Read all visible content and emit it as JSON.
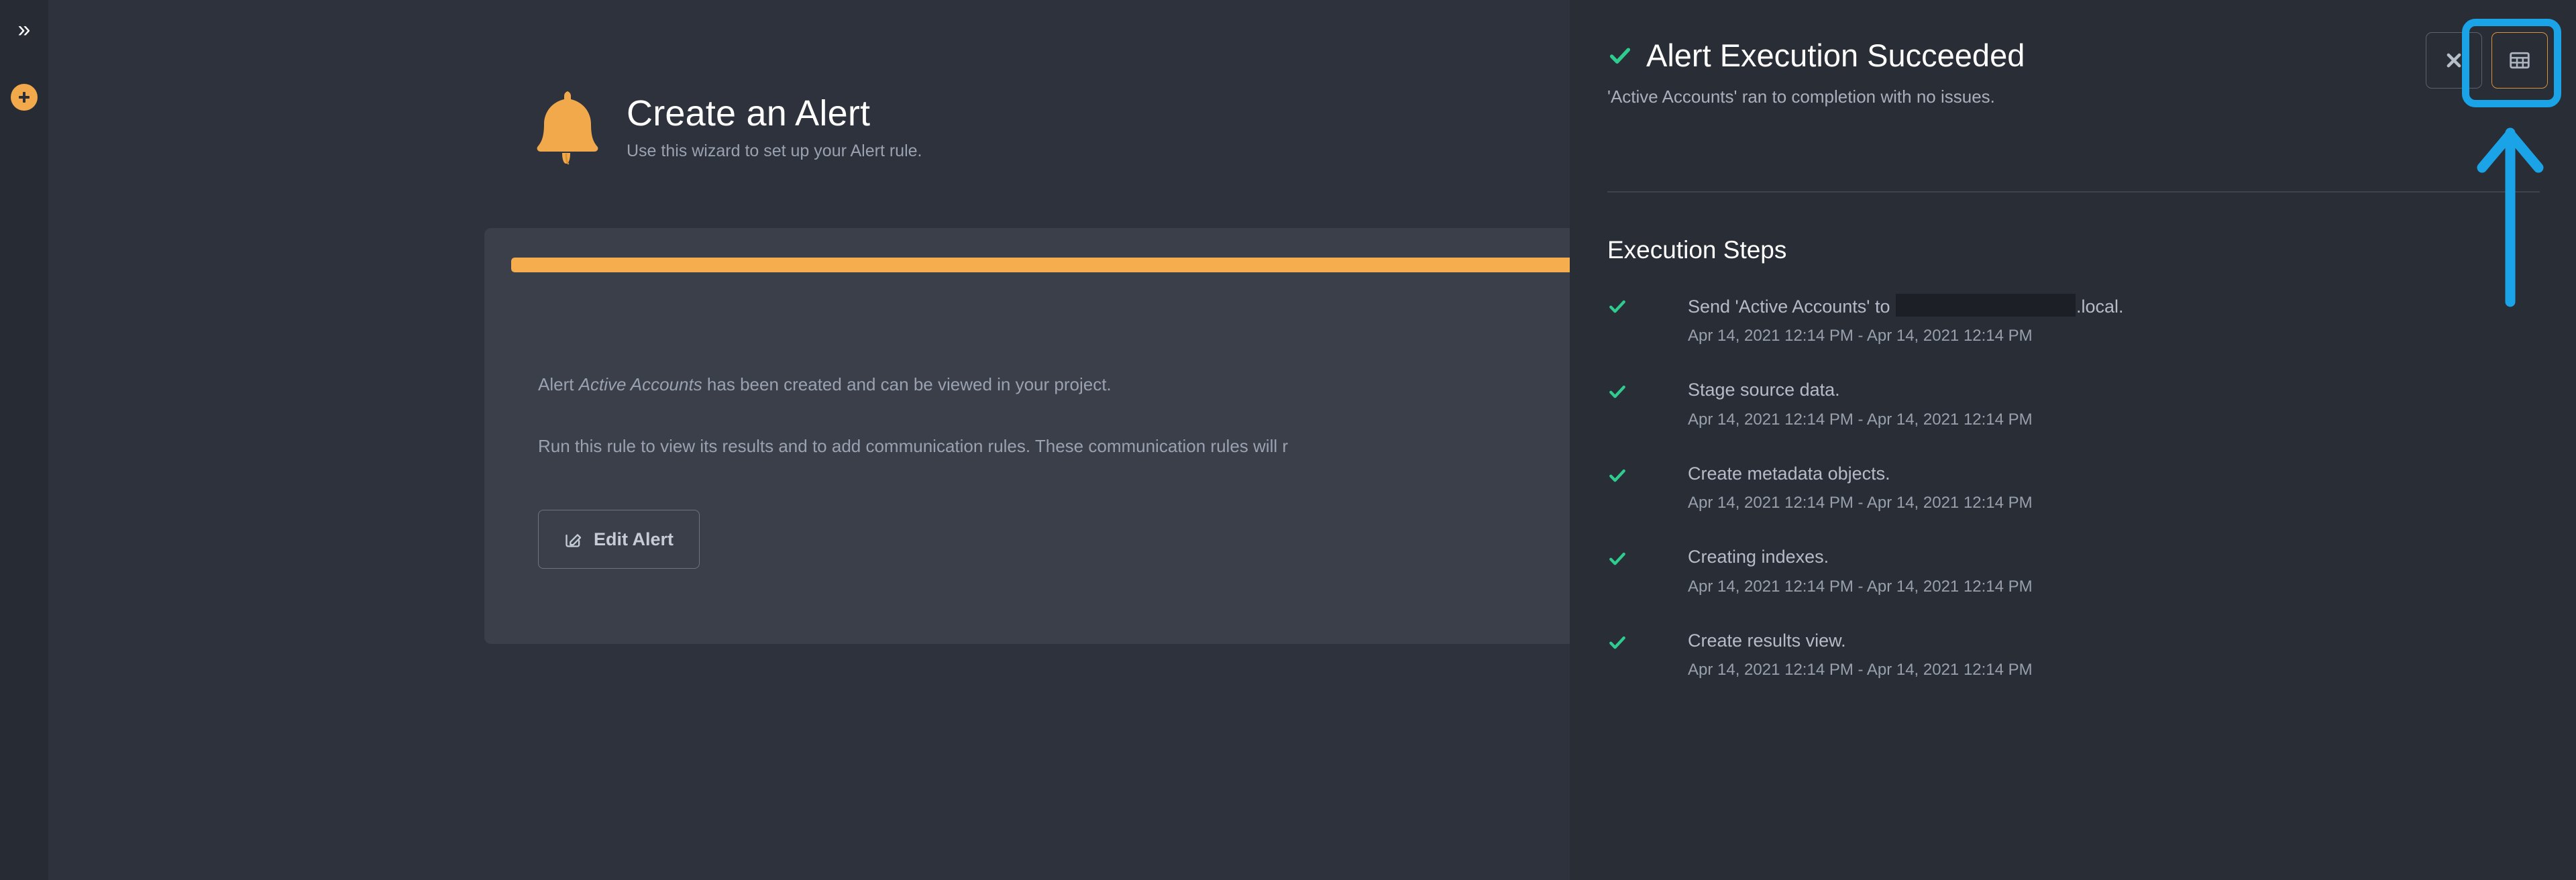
{
  "colors": {
    "page_background": "#2e323c",
    "card_background": "#3b3f4a",
    "panel_background": "#292d36",
    "rail_background": "#272b33",
    "accent_orange": "#f6ad4e",
    "success_green": "#2ecc8f",
    "highlight_cyan": "#1ba3e8",
    "redaction": "#1c1f26"
  },
  "left_rail": {
    "expand_icon": "double-chevron-right-icon",
    "expand_glyph": "»",
    "add_icon": "plus-circle-icon"
  },
  "wizard": {
    "icon": "bell-icon",
    "title": "Create an Alert",
    "subtitle": "Use this wizard to set up your Alert rule.",
    "progress": {
      "percent": 100,
      "label": ""
    },
    "body_line_1_prefix": "Alert ",
    "body_line_1_emphasis": "Active Accounts",
    "body_line_1_suffix": " has been created and can be viewed in your project.",
    "body_line_2": "Run this rule to view its results and to add communication rules. These communication rules will r",
    "edit_button": {
      "label": "Edit Alert",
      "icon": "edit-pencil-icon"
    },
    "secondary_button": {
      "label": ""
    }
  },
  "results_panel": {
    "status_icon": "check-icon",
    "title": "Alert Execution Succeeded",
    "subtitle": "'Active Accounts' ran to completion with no issues.",
    "steps_heading": "Execution Steps",
    "buttons": {
      "close": {
        "icon": "close-icon",
        "glyph": "✕",
        "label": ""
      },
      "table_view": {
        "icon": "table-grid-icon",
        "label": ""
      }
    },
    "steps": [
      {
        "icon": "check-icon",
        "label_prefix": "Send 'Active Accounts' to ",
        "label_redacted": true,
        "label_suffix": ".local.",
        "time": "Apr 14, 2021 12:14 PM - Apr 14, 2021 12:14 PM"
      },
      {
        "icon": "check-icon",
        "label_prefix": "Stage source data.",
        "label_redacted": false,
        "label_suffix": "",
        "time": "Apr 14, 2021 12:14 PM - Apr 14, 2021 12:14 PM"
      },
      {
        "icon": "check-icon",
        "label_prefix": "Create metadata objects.",
        "label_redacted": false,
        "label_suffix": "",
        "time": "Apr 14, 2021 12:14 PM - Apr 14, 2021 12:14 PM"
      },
      {
        "icon": "check-icon",
        "label_prefix": "Creating indexes.",
        "label_redacted": false,
        "label_suffix": "",
        "time": "Apr 14, 2021 12:14 PM - Apr 14, 2021 12:14 PM"
      },
      {
        "icon": "check-icon",
        "label_prefix": "Create results view.",
        "label_redacted": false,
        "label_suffix": "",
        "time": "Apr 14, 2021 12:14 PM - Apr 14, 2021 12:14 PM"
      }
    ]
  },
  "annotations": {
    "highlight_target": "table-view-button",
    "arrow_icon": "up-arrow-annotation"
  }
}
